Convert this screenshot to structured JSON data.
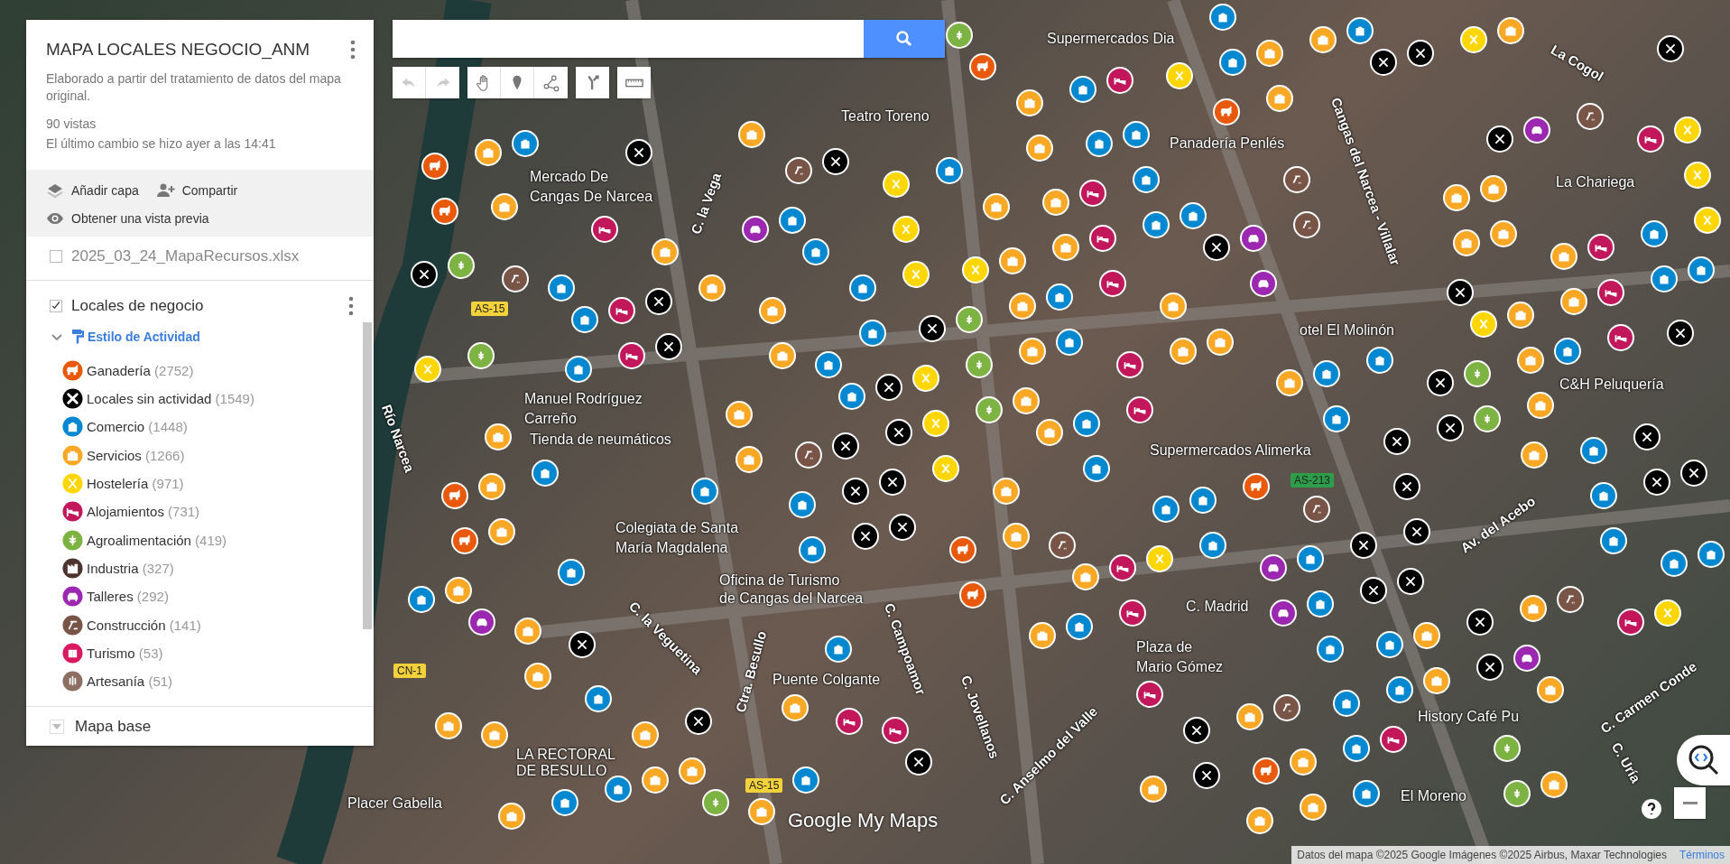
{
  "panel": {
    "title": "MAPA LOCALES NEGOCIO_ANM",
    "description": "Elaborado a partir del tratamiento de datos del mapa original.",
    "views": "90 vistas",
    "last_change": "El último cambio se hizo ayer a las 14:41",
    "actions": [
      {
        "label": "Añadir capa"
      },
      {
        "label": "Compartir"
      },
      {
        "label": "Obtener una vista previa"
      }
    ],
    "layers": [
      {
        "name": "2025_03_24_MapaRecursos.xlsx",
        "checked": false
      },
      {
        "name": "Locales de negocio",
        "checked": true
      }
    ],
    "style": {
      "label": "Estilo de Actividad",
      "expanded": true
    },
    "legend": [
      {
        "label": "Ganadería",
        "count": "(2752)",
        "color": "#e8590c"
      },
      {
        "label": "Locales sin actividad",
        "count": "(1549)",
        "color": "#000000"
      },
      {
        "label": "Comercio",
        "count": "(1448)",
        "color": "#0288d1"
      },
      {
        "label": "Servicios",
        "count": "(1266)",
        "color": "#f9a825"
      },
      {
        "label": "Hostelería",
        "count": "(971)",
        "color": "#ffd600"
      },
      {
        "label": "Alojamientos",
        "count": "(731)",
        "color": "#c2185b"
      },
      {
        "label": "Agroalimentación",
        "count": "(419)",
        "color": "#7cb342"
      },
      {
        "label": "Industria",
        "count": "(327)",
        "color": "#4e342e"
      },
      {
        "label": "Talleres",
        "count": "(292)",
        "color": "#9c27b0"
      },
      {
        "label": "Construcción",
        "count": "(141)",
        "color": "#795548"
      },
      {
        "label": "Turismo",
        "count": "(53)",
        "color": "#d81b60"
      },
      {
        "label": "Artesanía",
        "count": "(51)",
        "color": "#8d6e63"
      }
    ],
    "base_map": {
      "label": "Mapa base",
      "expanded": false
    }
  },
  "map_labels": [
    {
      "text": "Teatro Toreno"
    },
    {
      "text": "Supermercados Dia"
    },
    {
      "text": "Panadería Penlés"
    },
    {
      "text": "Mercado De"
    },
    {
      "text": "Cangas De Narcea"
    },
    {
      "text": "La Chariega"
    },
    {
      "text": "C&H Peluquería"
    },
    {
      "text": "Manuel Rodríguez"
    },
    {
      "text": "Carreño"
    },
    {
      "text": "Tienda de neumáticos"
    },
    {
      "text": "Supermercados Alimerka"
    },
    {
      "text": "Colegiata de Santa"
    },
    {
      "text": "María Magdalena"
    },
    {
      "text": "Oficina de Turismo"
    },
    {
      "text": "de Cangas del Narcea"
    },
    {
      "text": "Puente Colgante"
    },
    {
      "text": "LA RECTORAL"
    },
    {
      "text": "DE BESULLO"
    },
    {
      "text": "Placer Gabella"
    },
    {
      "text": "C. Madrid"
    },
    {
      "text": "Plaza de"
    },
    {
      "text": "Mario Gómez"
    },
    {
      "text": "History Café Pu"
    },
    {
      "text": "El Moreno"
    },
    {
      "text": "otel El Molinón"
    }
  ],
  "street_labels": [
    {
      "text": "Río Narcea"
    },
    {
      "text": "C. la Vega"
    },
    {
      "text": "Cangas del Narcea - Villalar"
    },
    {
      "text": "Av. del Acebo"
    },
    {
      "text": "C. Carmen Conde"
    },
    {
      "text": "C. Uría"
    },
    {
      "text": "C. Jovellanos"
    },
    {
      "text": "C. Campoamor"
    },
    {
      "text": "C. la Veguetina"
    },
    {
      "text": "Ctra. Besullo"
    },
    {
      "text": "C. Anselmo del Valle"
    },
    {
      "text": "La Cogol"
    }
  ],
  "road_shields": [
    {
      "text": "AS-15",
      "color": "#f2d13a"
    },
    {
      "text": "AS-213",
      "color": "#2e9d4a"
    },
    {
      "text": "CN-1",
      "color": "#f2d13a"
    },
    {
      "text": "AS-15",
      "color": "#f2d13a"
    }
  ],
  "logo": {
    "text": "Google My Maps"
  },
  "attribution": {
    "text": "Datos del mapa ©2025 Google Imágenes ©2025 Airbus, Maxar Technologies",
    "link": "Términos"
  }
}
